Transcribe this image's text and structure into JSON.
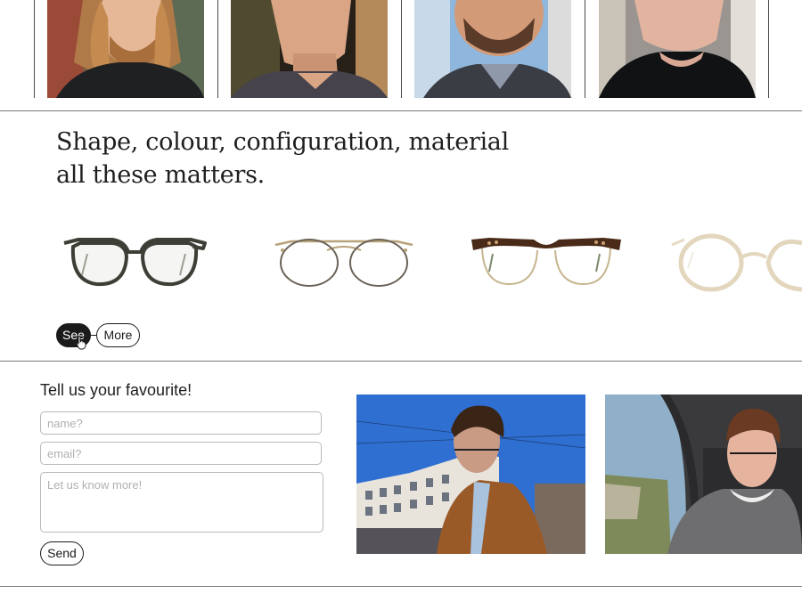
{
  "portraits": [
    {
      "label": "portrait-1",
      "icon": "portrait-photo"
    },
    {
      "label": "portrait-2",
      "icon": "portrait-photo"
    },
    {
      "label": "portrait-3",
      "icon": "portrait-photo"
    },
    {
      "label": "portrait-4",
      "icon": "portrait-photo"
    }
  ],
  "heading": {
    "line1": "Shape, colour, configuration, material",
    "line2": "all these matters."
  },
  "glasses": [
    {
      "icon": "dark-acetate-frame"
    },
    {
      "icon": "gold-double-bridge-frame"
    },
    {
      "icon": "tortoise-browline-frame"
    },
    {
      "icon": "clear-round-frame"
    }
  ],
  "actions": {
    "see_label": "See",
    "more_label": "More"
  },
  "form": {
    "title": "Tell us your favourite!",
    "name_placeholder": "name?",
    "email_placeholder": "email?",
    "message_placeholder": "Let us know more!",
    "name_value": "",
    "email_value": "",
    "message_value": "",
    "send_label": "Send"
  },
  "photos": [
    {
      "icon": "street-photo"
    },
    {
      "icon": "train-window-photo"
    }
  ],
  "colors": {
    "ink": "#1b1b1b",
    "rule": "#7a7a7a",
    "field_border": "#b9b9b9",
    "placeholder": "#b0b0b0",
    "sky": "#2f6fd1"
  }
}
